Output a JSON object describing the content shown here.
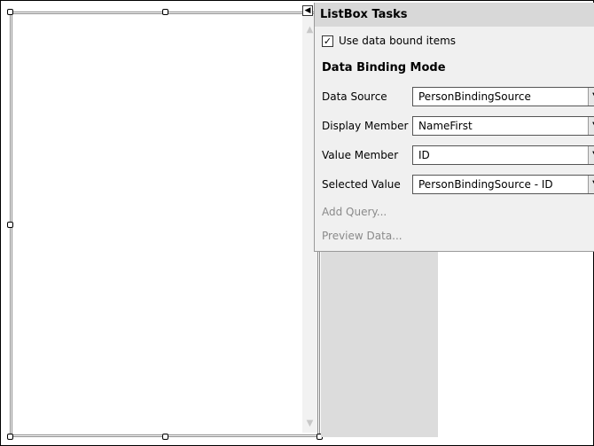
{
  "panel": {
    "title": "ListBox Tasks",
    "checkbox_label": "Use data bound items",
    "checkbox_checked": true,
    "section_title": "Data Binding Mode",
    "fields": [
      {
        "label": "Data Source",
        "value": "PersonBindingSource"
      },
      {
        "label": "Display Member",
        "value": "NameFirst"
      },
      {
        "label": "Value Member",
        "value": "ID"
      },
      {
        "label": "Selected Value",
        "value": "PersonBindingSource - ID"
      }
    ],
    "links": {
      "add_query": "Add Query...",
      "preview_data": "Preview Data..."
    }
  },
  "glyphs": {
    "check": "✓",
    "dropdown": "▼",
    "smart_tag": "◀",
    "scroll_up": "▲",
    "scroll_down": "▼"
  }
}
